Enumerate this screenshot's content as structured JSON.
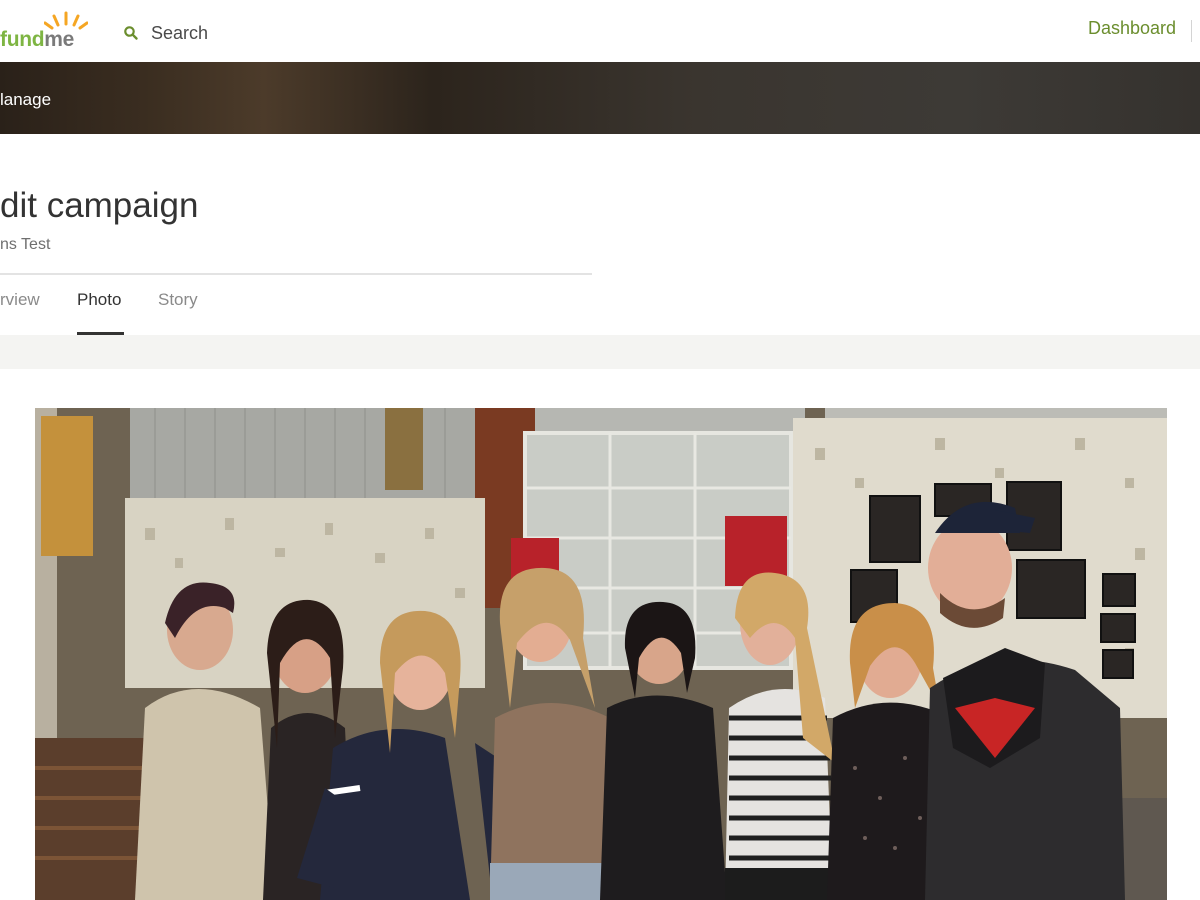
{
  "header": {
    "logo": {
      "part1": "fund",
      "part2": "me"
    },
    "search_label": "Search",
    "dashboard_label": "Dashboard"
  },
  "banner": {
    "label": "lanage"
  },
  "page": {
    "title": "dit campaign",
    "subtitle": "ns Test"
  },
  "tabs": [
    {
      "label": "rview",
      "active": false
    },
    {
      "label": "Photo",
      "active": true
    },
    {
      "label": "Story",
      "active": false
    }
  ],
  "colors": {
    "brand_green": "#7eb543",
    "link_green": "#6b8e2e",
    "banner_dark": "#2c241c",
    "text_dark": "#333333"
  },
  "icons": {
    "search": "search-icon",
    "logo_sun": "sun-icon"
  },
  "photo": {
    "description_visible": false
  }
}
